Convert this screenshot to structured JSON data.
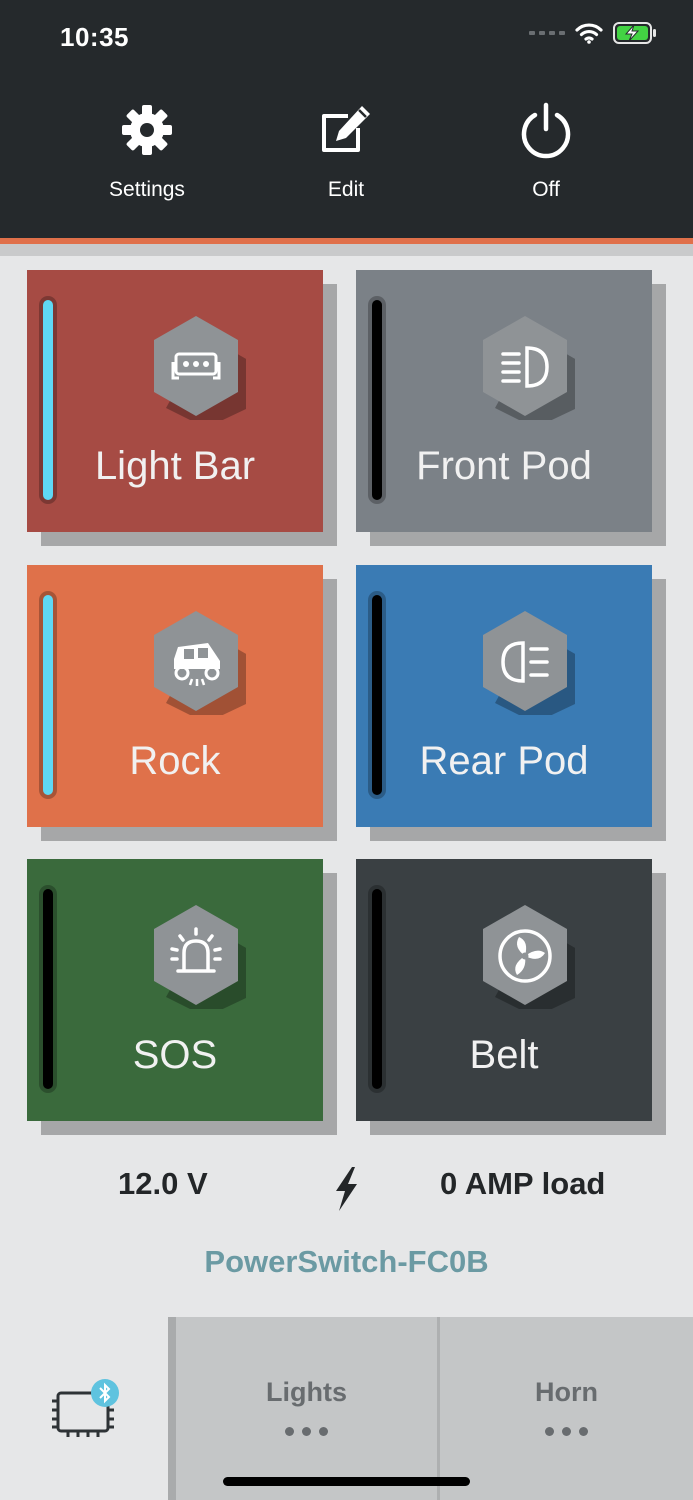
{
  "status": {
    "time": "10:35"
  },
  "toolbar": {
    "settings": "Settings",
    "edit": "Edit",
    "off": "Off"
  },
  "tiles": [
    {
      "label": "Light Bar",
      "color": "#a64b44",
      "hex_color": "#8f9396",
      "icon": "light-bar-icon",
      "on": true
    },
    {
      "label": "Front Pod",
      "color": "#7b8187",
      "hex_color": "#8f9396",
      "icon": "headlight-icon",
      "on": false
    },
    {
      "label": "Rock",
      "color": "#df714a",
      "hex_color": "#8f9396",
      "icon": "utv-rock-icon",
      "on": true
    },
    {
      "label": "Rear Pod",
      "color": "#3a7bb4",
      "hex_color": "#8f9396",
      "icon": "rear-light-icon",
      "on": false
    },
    {
      "label": "SOS",
      "color": "#3a6a3c",
      "hex_color": "#8f9396",
      "icon": "siren-icon",
      "on": false
    },
    {
      "label": "Belt",
      "color": "#3a4043",
      "hex_color": "#8f9396",
      "icon": "fan-icon",
      "on": false
    }
  ],
  "info": {
    "voltage": "12.0 V",
    "load": "0 AMP load",
    "device_name": "PowerSwitch-FC0B"
  },
  "tabs": {
    "lights": "Lights",
    "horn": "Horn"
  },
  "colors": {
    "accent": "#e0704a",
    "indicator_on": "#5fd8f4",
    "bluetooth_badge": "#5fc3df"
  }
}
